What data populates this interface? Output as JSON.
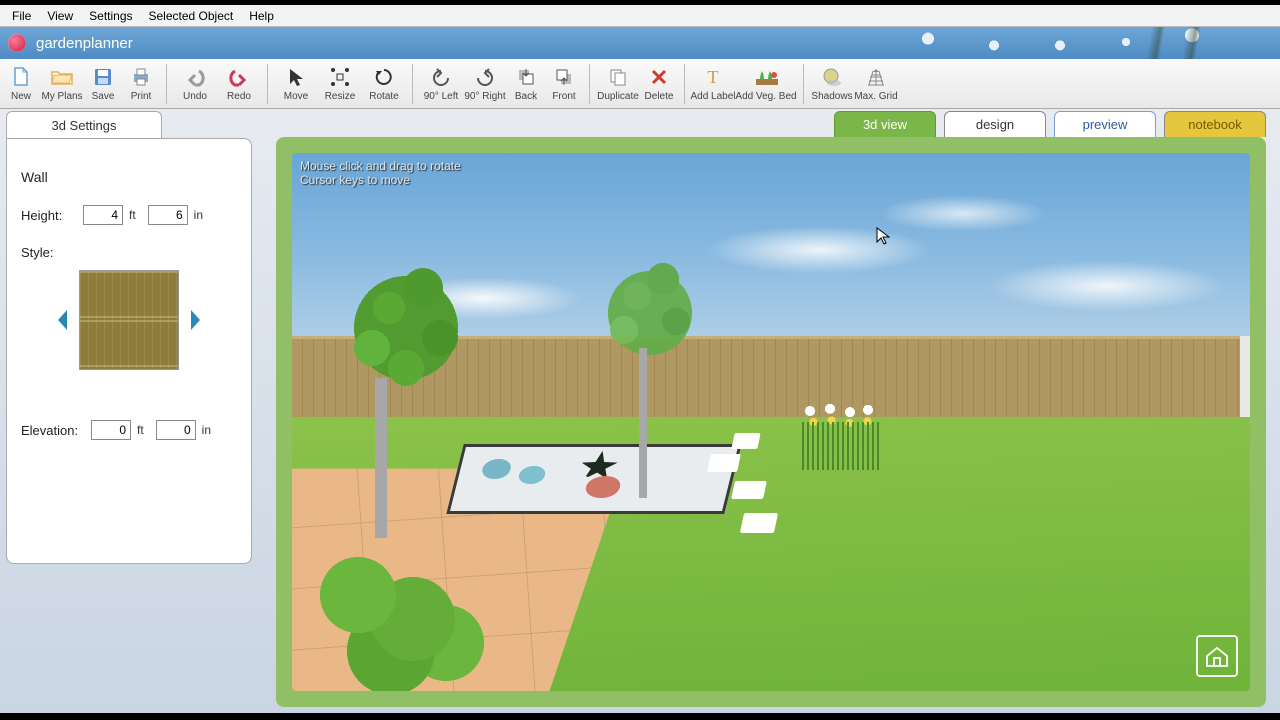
{
  "menubar": {
    "file": "File",
    "view": "View",
    "settings": "Settings",
    "selected_object": "Selected Object",
    "help": "Help"
  },
  "app": {
    "title": "gardenplanner"
  },
  "toolbar": {
    "new": "New",
    "myplans": "My Plans",
    "save": "Save",
    "print": "Print",
    "undo": "Undo",
    "redo": "Redo",
    "move": "Move",
    "resize": "Resize",
    "rotate": "Rotate",
    "left90": "90° Left",
    "right90": "90° Right",
    "back": "Back",
    "front": "Front",
    "duplicate": "Duplicate",
    "delete": "Delete",
    "addlabel": "Add Label",
    "addveg": "Add Veg. Bed",
    "shadows": "Shadows",
    "maxgrid": "Max. Grid"
  },
  "view_tabs": {
    "view3d": "3d view",
    "design": "design",
    "preview": "preview",
    "notebook": "notebook"
  },
  "panel": {
    "tab": "3d Settings",
    "object": "Wall",
    "height_label": "Height:",
    "elevation_label": "Elevation:",
    "style_label": "Style:",
    "height_ft": "4",
    "height_in": "6",
    "elev_ft": "0",
    "elev_in": "0",
    "unit_ft": "ft",
    "unit_in": "in"
  },
  "hint": {
    "line1": "Mouse click and drag to rotate",
    "line2": "Cursor keys to move"
  }
}
